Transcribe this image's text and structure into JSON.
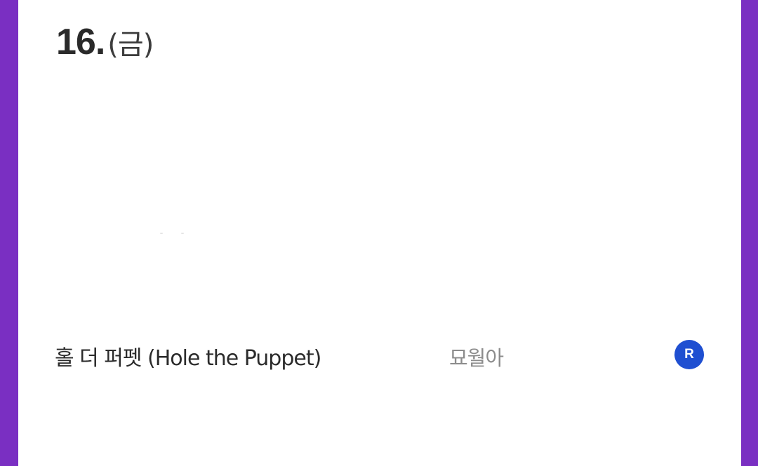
{
  "header": {
    "day": "16.",
    "weekday": "(금)"
  },
  "list": {
    "items": [
      {
        "title": "홀 더 퍼펫 (Hole the Puppet)",
        "author": "묘월아",
        "badge": "R",
        "badge_color": "#1f4fd1"
      }
    ]
  },
  "colors": {
    "frame": "#7a2fc2",
    "card": "#ffffff"
  }
}
